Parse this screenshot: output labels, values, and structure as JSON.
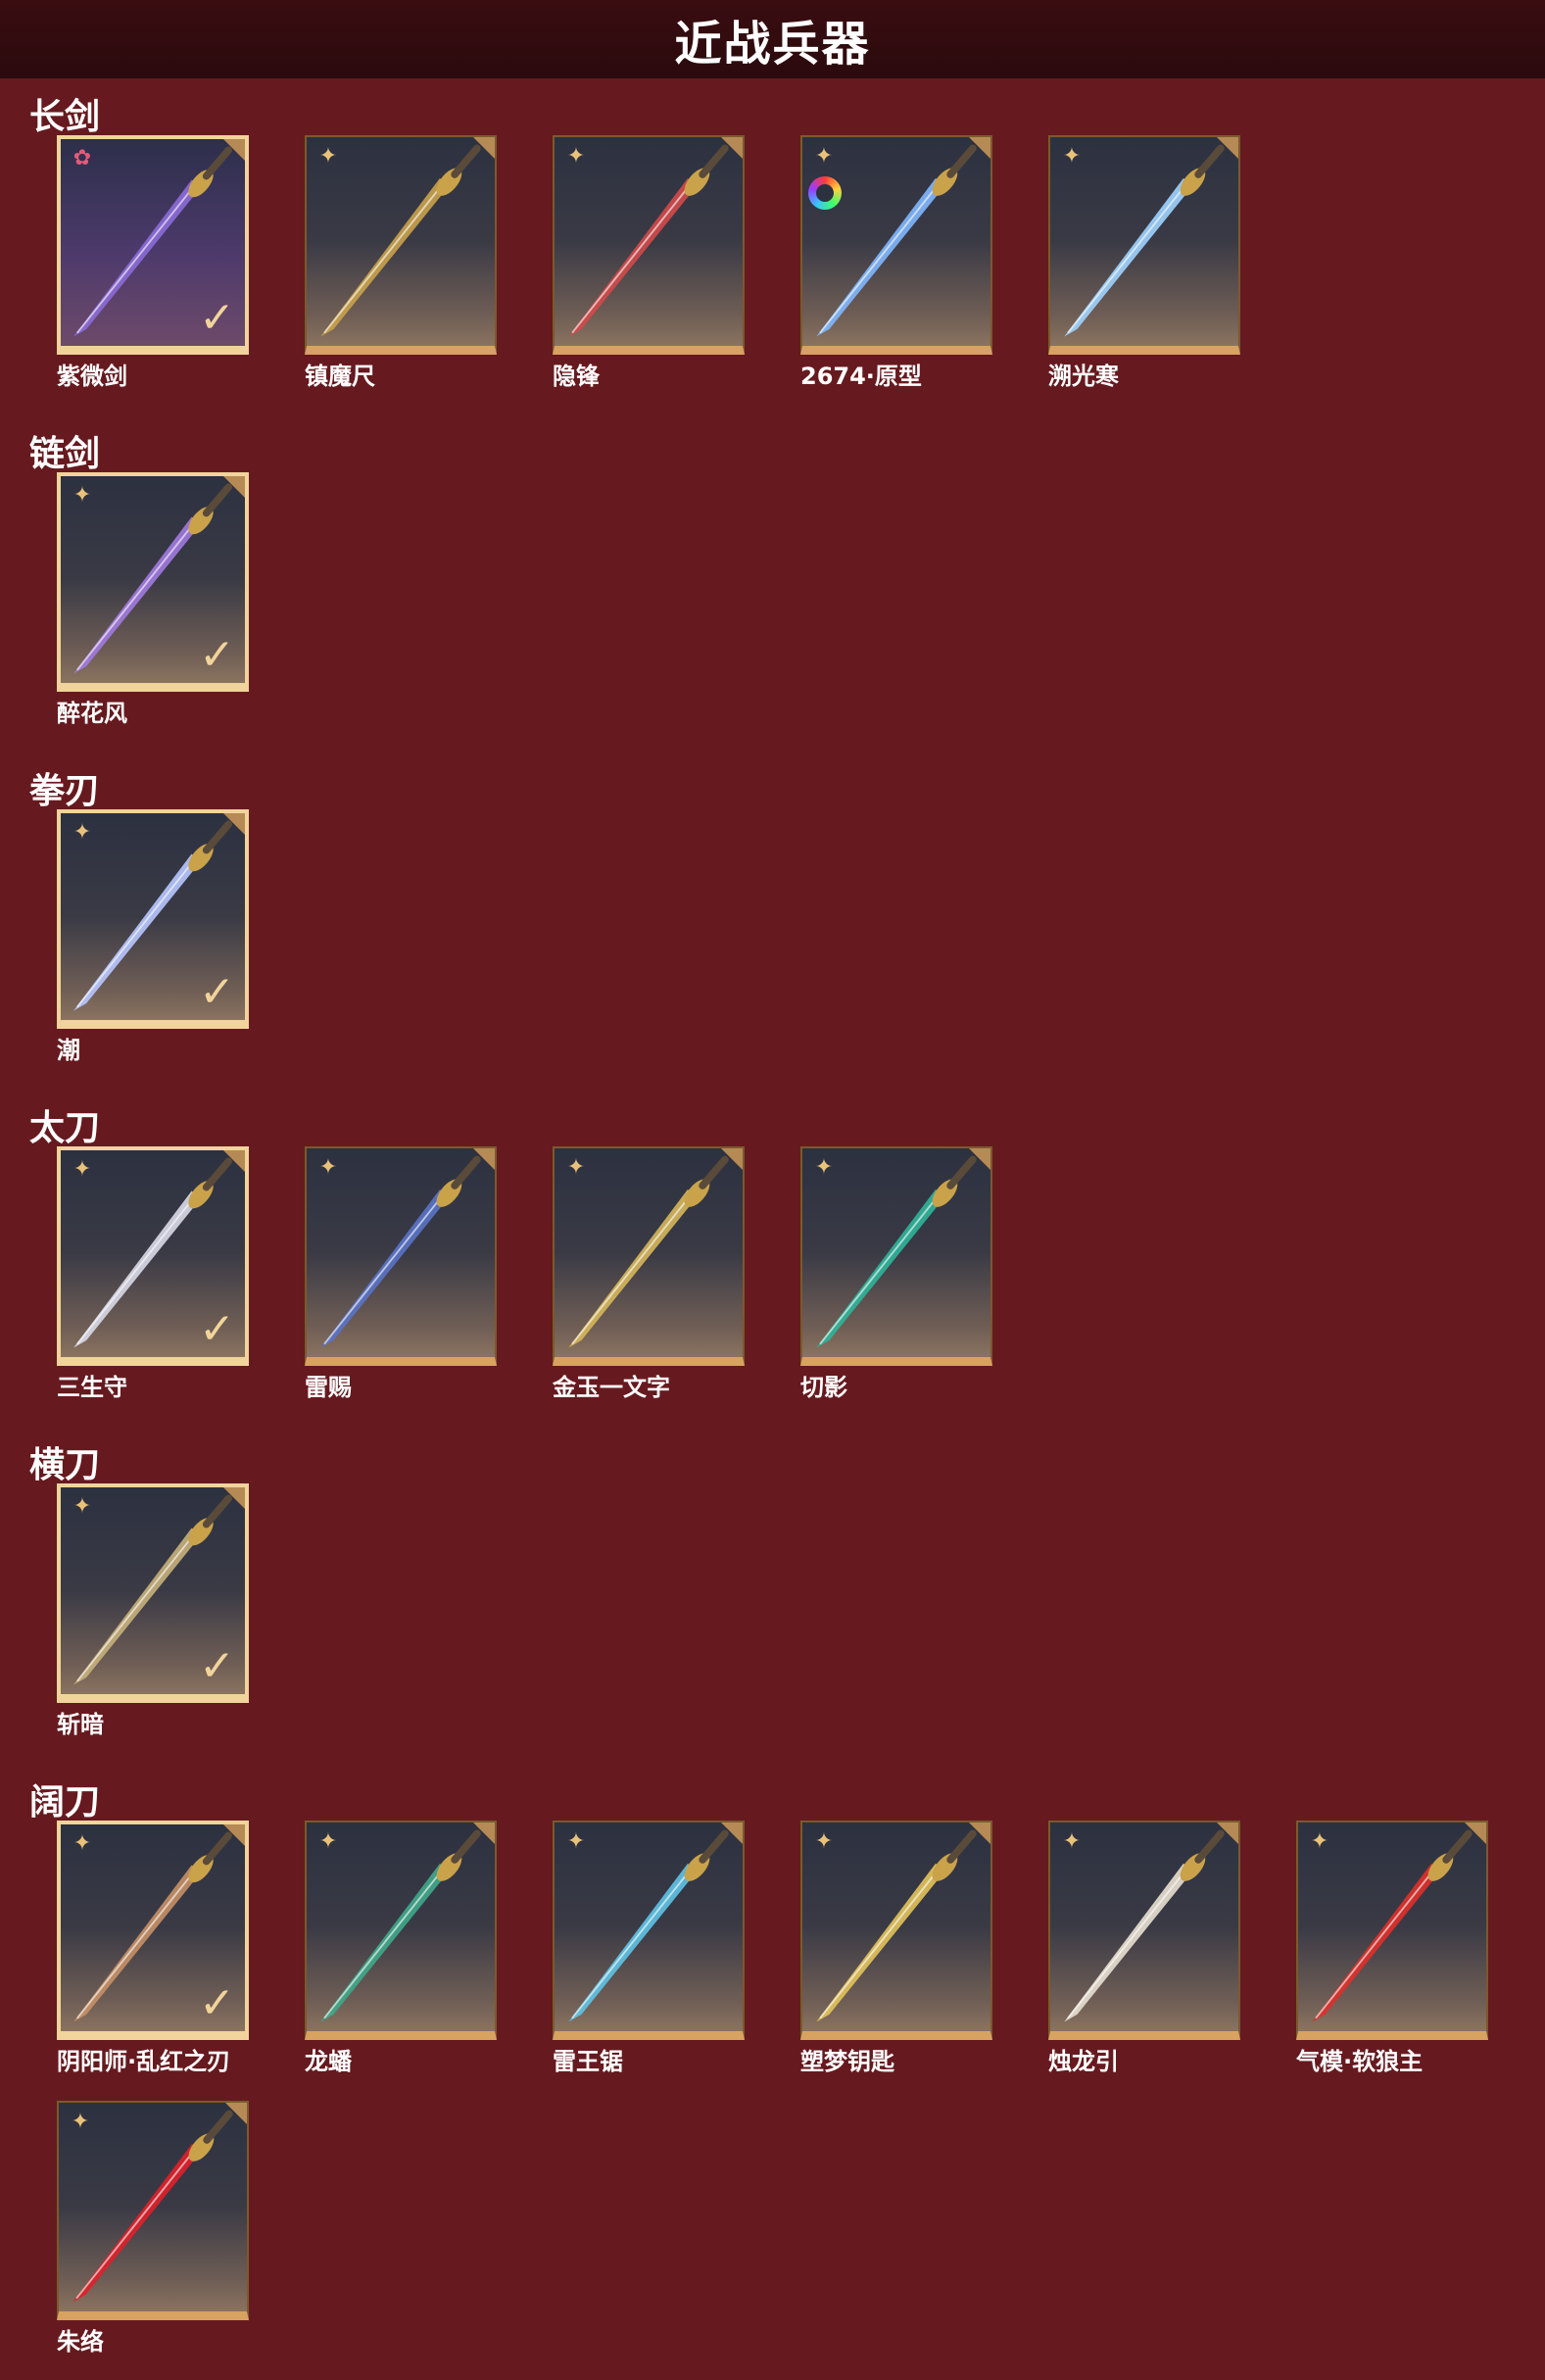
{
  "header": {
    "title": "近战兵器"
  },
  "categories": [
    {
      "name": "长剑",
      "items": [
        {
          "name": "紫微剑",
          "equipped": true,
          "badge": "rose-star-icon",
          "color": "#8c6cd8"
        },
        {
          "name": "镇魔尺",
          "equipped": false,
          "badge": "shuriken-icon",
          "color": "#c9a24a"
        },
        {
          "name": "隐锋",
          "equipped": false,
          "badge": "shuriken-icon",
          "color": "#d24a4a"
        },
        {
          "name": "2674·原型",
          "equipped": false,
          "badge": "rainbow-ring-icon",
          "color": "#7fb7ff"
        },
        {
          "name": "溯光寒",
          "equipped": false,
          "badge": "shuriken-icon",
          "color": "#9ed3ff"
        }
      ]
    },
    {
      "name": "链剑",
      "items": [
        {
          "name": "醉花风",
          "equipped": true,
          "badge": "shuriken-icon",
          "color": "#a27ae0"
        }
      ]
    },
    {
      "name": "拳刃",
      "items": [
        {
          "name": "潮",
          "equipped": true,
          "badge": "shuriken-icon",
          "color": "#b7c7ff"
        }
      ]
    },
    {
      "name": "太刀",
      "items": [
        {
          "name": "三生守",
          "equipped": true,
          "badge": "shuriken-icon",
          "color": "#d9d9e8"
        },
        {
          "name": "雷赐",
          "equipped": false,
          "badge": "shuriken-icon",
          "color": "#5a73c7"
        },
        {
          "name": "金玉一文字",
          "equipped": false,
          "badge": "shuriken-icon",
          "color": "#d6b75a"
        },
        {
          "name": "切影",
          "equipped": false,
          "badge": "shuriken-icon",
          "color": "#2fb59a"
        }
      ]
    },
    {
      "name": "横刀",
      "items": [
        {
          "name": "斩暗",
          "equipped": true,
          "badge": "shuriken-icon",
          "color": "#c7b07a"
        }
      ]
    },
    {
      "name": "阔刀",
      "items": [
        {
          "name": "阴阳师·乱红之刃",
          "equipped": true,
          "badge": "shuriken-icon",
          "color": "#c79066"
        },
        {
          "name": "龙蟠",
          "equipped": false,
          "badge": "shuriken-icon",
          "color": "#3fa98a"
        },
        {
          "name": "雷王锯",
          "equipped": false,
          "badge": "shuriken-icon",
          "color": "#5ec3e6"
        },
        {
          "name": "塑梦钥匙",
          "equipped": false,
          "badge": "shuriken-icon",
          "color": "#e3c35a"
        },
        {
          "name": "烛龙引",
          "equipped": false,
          "badge": "shuriken-icon",
          "color": "#e8e0d0"
        },
        {
          "name": "气模·软狼主",
          "equipped": false,
          "badge": "shuriken-icon",
          "color": "#e0302a"
        },
        {
          "name": "朱络",
          "equipped": false,
          "badge": "shuriken-icon",
          "color": "#e0202a"
        }
      ]
    }
  ]
}
